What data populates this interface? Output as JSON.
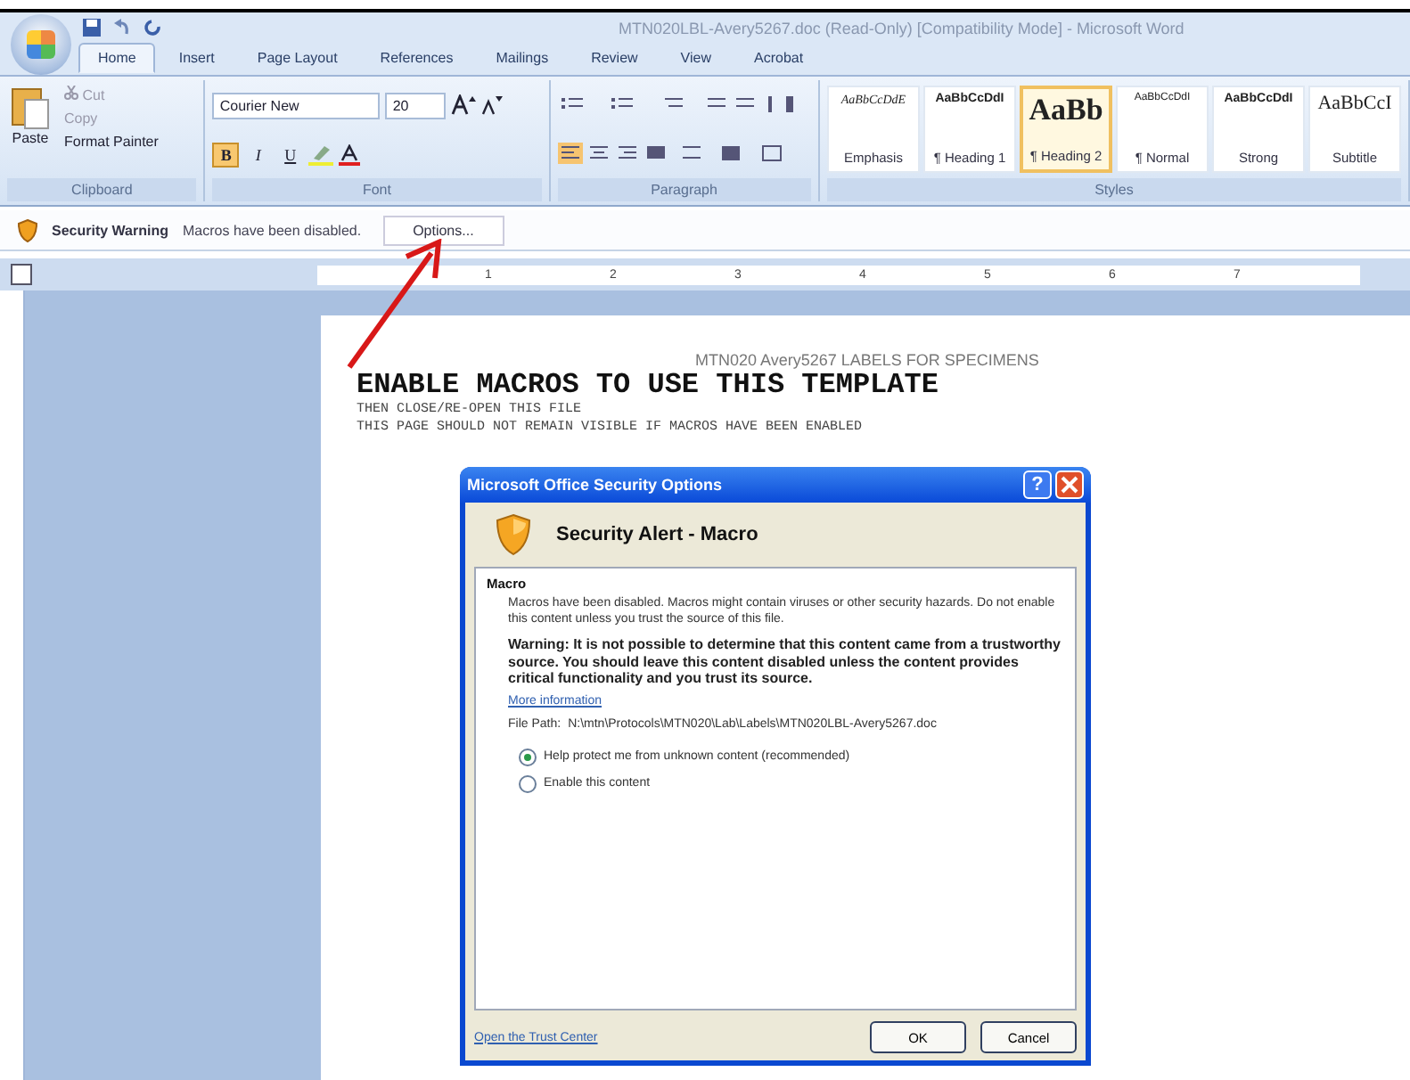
{
  "window": {
    "title": "MTN020LBL-Avery5267.doc (Read-Only) [Compatibility Mode] - Microsoft Word"
  },
  "tabs": [
    {
      "label": "Home",
      "selected": true
    },
    {
      "label": "Insert",
      "selected": false
    },
    {
      "label": "Page Layout",
      "selected": false
    },
    {
      "label": "References",
      "selected": false
    },
    {
      "label": "Mailings",
      "selected": false
    },
    {
      "label": "Review",
      "selected": false
    },
    {
      "label": "View",
      "selected": false
    },
    {
      "label": "Acrobat",
      "selected": false
    }
  ],
  "clipboard": {
    "paste": "Paste",
    "cut": "Cut",
    "copy": "Copy",
    "format_painter": "Format Painter",
    "label": "Clipboard"
  },
  "font": {
    "name": "Courier New",
    "size": "20",
    "label": "Font",
    "format_buttons": [
      {
        "label": "B",
        "kind": "bold",
        "selected": true
      },
      {
        "label": "I",
        "kind": "italic",
        "selected": false
      },
      {
        "label": "U",
        "kind": "underline",
        "selected": false
      }
    ]
  },
  "paragraph": {
    "label": "Paragraph"
  },
  "styles": {
    "label": "Styles",
    "items": [
      {
        "preview": "AaBbCcDdE",
        "name": "Emphasis",
        "kind": "italic",
        "selected": false
      },
      {
        "preview": "AaBbCcDdI",
        "name": "¶ Heading 1",
        "kind": "bold",
        "selected": false
      },
      {
        "preview": "AaBb",
        "name": "¶ Heading 2",
        "kind": "large",
        "selected": true
      },
      {
        "preview": "AaBbCcDdI",
        "name": "¶ Normal",
        "kind": "plain",
        "selected": false
      },
      {
        "preview": "AaBbCcDdI",
        "name": "Strong",
        "kind": "bold",
        "selected": false
      },
      {
        "preview": "AaBbCcI",
        "name": "Subtitle",
        "kind": "serif",
        "selected": false
      }
    ]
  },
  "security_bar": {
    "label": "Security Warning",
    "message": "Macros have been disabled.",
    "button": "Options..."
  },
  "ruler": {
    "numbers": [
      "1",
      "2",
      "3",
      "4",
      "5",
      "6",
      "7"
    ]
  },
  "document": {
    "header": "MTN020 Avery5267 LABELS FOR SPECIMENS",
    "title": "ENABLE MACROS TO USE THIS TEMPLATE",
    "lines": [
      "THEN CLOSE/RE-OPEN THIS FILE",
      "THIS PAGE SHOULD NOT REMAIN VISIBLE IF MACROS HAVE BEEN ENABLED"
    ]
  },
  "dialog": {
    "title": "Microsoft Office Security Options",
    "help": "?",
    "alert_title": "Security Alert - Macro",
    "section": "Macro",
    "text": "Macros have been disabled. Macros might contain viruses or other security hazards. Do not enable this content unless you trust the source of this file.",
    "warning": "Warning: It is not possible to determine that this content came from a trustworthy source. You should leave this content disabled unless the content provides critical functionality and you trust its source.",
    "more_info": "More information",
    "file_path_label": "File Path:",
    "file_path": "N:\\mtn\\Protocols\\MTN020\\Lab\\Labels\\MTN020LBL-Avery5267.doc",
    "options": [
      {
        "label": "Help protect me from unknown content (recommended)",
        "selected": true
      },
      {
        "label": "Enable this content",
        "selected": false
      }
    ],
    "trust_center": "Open the Trust Center",
    "buttons": [
      "OK",
      "Cancel"
    ]
  }
}
